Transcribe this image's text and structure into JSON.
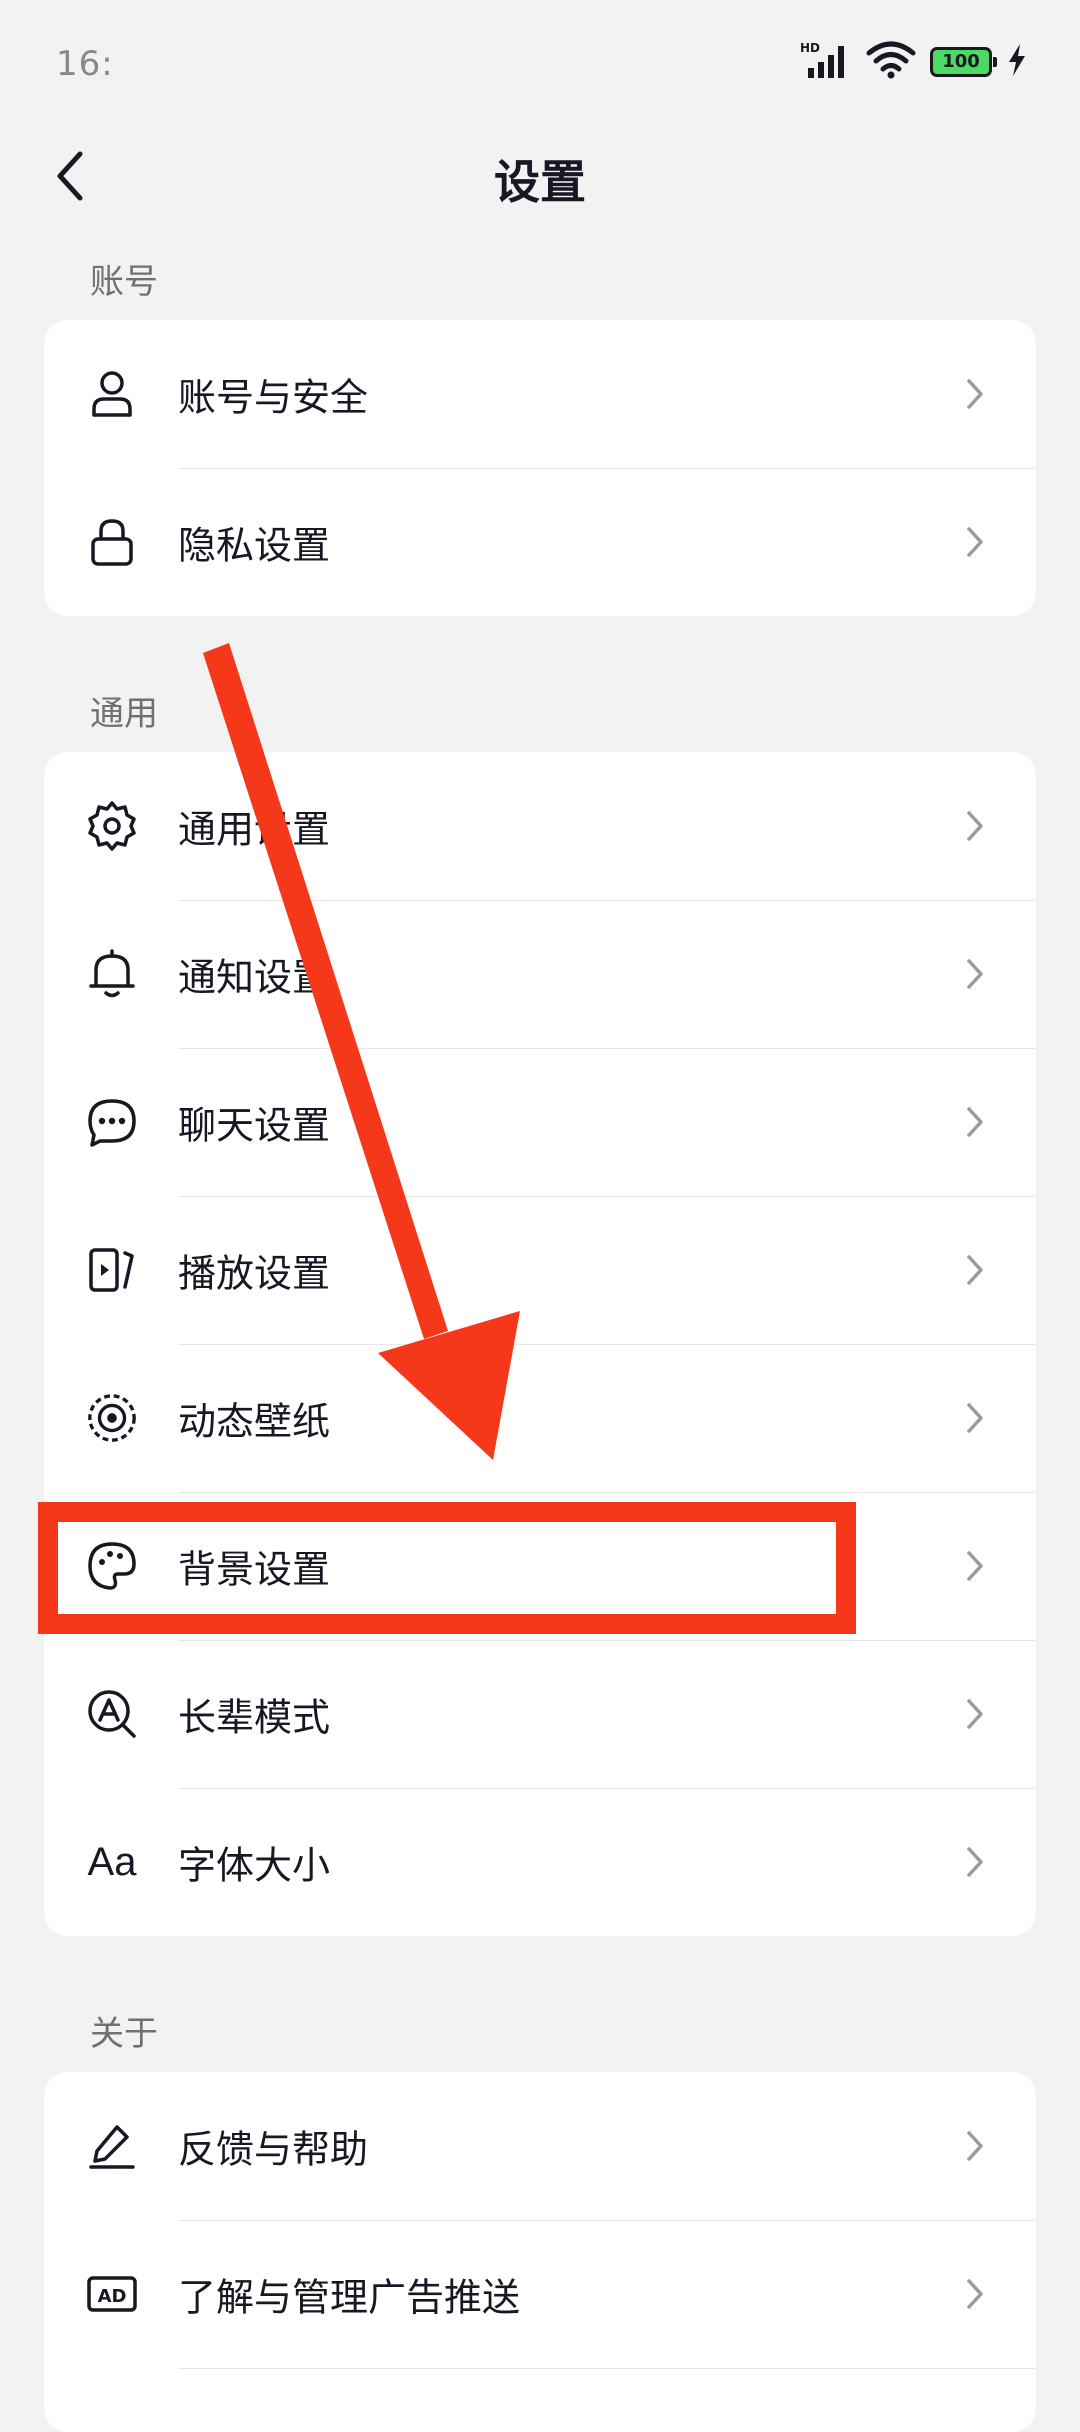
{
  "status_bar": {
    "time": "16:",
    "battery": "100",
    "icons": [
      "hd-signal-icon",
      "wifi-icon",
      "battery-icon",
      "charging-icon"
    ]
  },
  "header": {
    "title": "设置",
    "back_icon": "back-arrow-icon"
  },
  "sections": {
    "account": {
      "label": "账号",
      "items": [
        {
          "label": "账号与安全",
          "icon": "user-icon"
        },
        {
          "label": "隐私设置",
          "icon": "lock-icon"
        }
      ]
    },
    "general": {
      "label": "通用",
      "items": [
        {
          "label": "通用设置",
          "icon": "gear-icon"
        },
        {
          "label": "通知设置",
          "icon": "bell-icon"
        },
        {
          "label": "聊天设置",
          "icon": "chat-icon"
        },
        {
          "label": "播放设置",
          "icon": "play-icon"
        },
        {
          "label": "动态壁纸",
          "icon": "wallpaper-icon"
        },
        {
          "label": "背景设置",
          "icon": "palette-icon"
        },
        {
          "label": "长辈模式",
          "icon": "elder-mode-icon"
        },
        {
          "label": "字体大小",
          "icon": "font-size-icon",
          "icon_text": "Aa"
        }
      ]
    },
    "about": {
      "label": "关于",
      "items": [
        {
          "label": "反馈与帮助",
          "icon": "pencil-icon"
        },
        {
          "label": "了解与管理广告推送",
          "icon": "ad-icon",
          "icon_text": "AD"
        }
      ]
    }
  },
  "colors": {
    "background": "#f2f2f2",
    "card": "#ffffff",
    "annotation": "#f5371a",
    "text": "#161823",
    "secondary_text": "#6f7072"
  }
}
